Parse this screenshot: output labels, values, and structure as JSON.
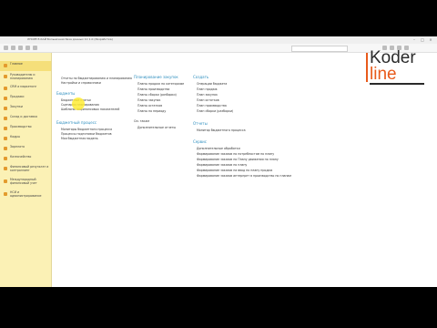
{
  "window": {
    "title": "ЛНОРЕ Е-КАЙ Больничная база данных 1С 1.0 (Разработка)"
  },
  "colors": {
    "sidebar_bg": "#fbf1b5",
    "accent": "#e39b2e",
    "link_header": "#2f8fbf",
    "logo_orange": "#e85a1b"
  },
  "sidebar": {
    "items": [
      {
        "label": "Главное",
        "icon": "star-icon"
      },
      {
        "label": "Руководителю и планированию",
        "icon": "chart-icon"
      },
      {
        "label": "CRM и маркетинг",
        "icon": "people-icon"
      },
      {
        "label": "Продажи",
        "icon": "cart-icon"
      },
      {
        "label": "Закупки",
        "icon": "truck-icon"
      },
      {
        "label": "Склад и доставка",
        "icon": "box-icon"
      },
      {
        "label": "Производство",
        "icon": "factory-icon"
      },
      {
        "label": "Кадры",
        "icon": "person-icon"
      },
      {
        "label": "Зарплата",
        "icon": "money-icon"
      },
      {
        "label": "Казначейство",
        "icon": "bank-icon"
      },
      {
        "label": "Финансовый результат и контроллинг",
        "icon": "calc-icon"
      },
      {
        "label": "Международный финансовый учет",
        "icon": "globe-icon"
      },
      {
        "label": "НСИ и администрирование",
        "icon": "gear-icon"
      }
    ]
  },
  "logo": {
    "line1": "Koder",
    "line2": "line"
  },
  "main": {
    "col1": {
      "top_links": [
        "Отчеты по бюджетированию и планированию",
        "Настройки и справочники"
      ],
      "budget_header": "Бюджеты",
      "budget_links": [
        "Бюджетные статьи",
        "Сценарии планирования",
        "Шаблоны нефинансовых показателей"
      ],
      "process_header": "Бюджетный процесс",
      "process_links": [
        "Мониторы бюджетного процесса",
        "Процессы подготовки бюджетов",
        "Моя бюджетная модель"
      ]
    },
    "col2": {
      "plan_header": "Планирование закупок",
      "plan_links": [
        "Планы продаж по категориям",
        "Планы производства",
        "Планы сборки (разборки)",
        "Планы закупок",
        "Планы остатков",
        "Планы по периоду"
      ],
      "also_header": "См. также",
      "also_links": [
        "Дополнительные отчеты"
      ]
    },
    "col3": {
      "create_header": "Создать",
      "create_links": [
        "Операции бюджета",
        "План продаж",
        "План закупок",
        "План остатков",
        "План производства",
        "План сборки (разборки)"
      ],
      "reports_header": "Отчеты",
      "reports_links": [
        "Монитор бюджетного процесса"
      ],
      "service_header": "Сервис",
      "service_links": [
        "Дополнительные обработки",
        "Формирование заказов по потребностям по плану",
        "Формирование заказов по Плану движения по плану",
        "Формирование заказов по плану",
        "Формирование заказов на ввод по плану продаж",
        "Формирование заказов интерпрет в производство по планам"
      ]
    }
  }
}
